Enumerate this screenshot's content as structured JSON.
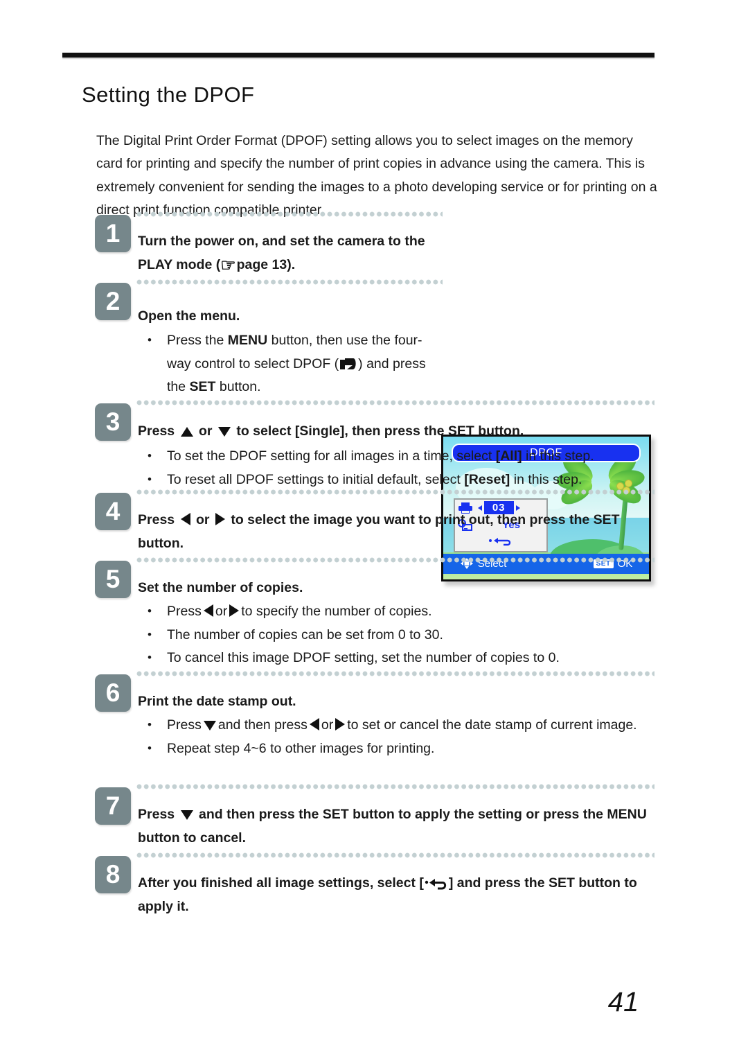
{
  "document": {
    "title": "Setting the DPOF",
    "page_number": "41",
    "intro": "The Digital Print Order Format (DPOF) setting allows you to select images on the memory card for printing and specify the number of print copies in advance using the camera. This is extremely convenient for sending the images to a photo developing service or for printing on a direct print function compatible printer."
  },
  "steps": {
    "s1": {
      "number": "1",
      "text_a": "Turn the power on, and set the camera to the PLAY mode (",
      "text_b": "page 13)."
    },
    "s2": {
      "number": "2",
      "heading": "Open the menu.",
      "bullet_a": "Press the ",
      "bullet_menu": "MENU",
      "bullet_b": " button, then use the four-way control to select DPOF (",
      "bullet_c": ") and press the ",
      "bullet_set": "SET",
      "bullet_d": " button."
    },
    "s3": {
      "number": "3",
      "lead": "Press",
      "or": "or",
      "tail": "to select [Single], then press the SET button.",
      "bullets": [
        {
          "a": "To set the DPOF setting for all images in a time, select ",
          "bold": "[All]",
          "b": " in this step."
        },
        {
          "a": "To reset all DPOF settings to initial default, select ",
          "bold": "[Reset]",
          "b": " in this step."
        }
      ]
    },
    "s4": {
      "number": "4",
      "lead": "Press",
      "or": "or",
      "tail": "to select the image you want to print out, then press the SET button."
    },
    "s5": {
      "number": "5",
      "heading": "Set the number of copies.",
      "bullet1_lead": "Press",
      "bullet1_or": "or",
      "bullet1_tail": "to specify the number of copies.",
      "bullet2": "The number of copies can be set from 0 to 30.",
      "bullet3": "To cancel this image DPOF setting, set the number of copies to 0."
    },
    "s6": {
      "number": "6",
      "heading": "Print the date stamp out.",
      "bullet1_a": "Press",
      "bullet1_b": "and then press",
      "bullet1_or": "or",
      "bullet1_c": "to set or cancel the date stamp of current image.",
      "bullet2": "Repeat step 4~6 to other images for printing."
    },
    "s7": {
      "number": "7",
      "lead": "Press",
      "tail": "and then press the SET button to apply the setting or press the MENU button to cancel."
    },
    "s8": {
      "number": "8",
      "lead": "After you finished all image settings, select [",
      "tail": "] and press the SET button to apply it."
    }
  },
  "lcd": {
    "title": "DPOF",
    "copies_value": "03",
    "datestamp_value": "Yes",
    "hint_select": "Select",
    "hint_set_chip": "SET",
    "hint_ok": "OK",
    "icons": {
      "printer": "printer-icon",
      "datestamp": "date-stamp-icon",
      "return": "return-arrow-icon",
      "fourway": "four-way-icon"
    }
  },
  "icons": {
    "hand": "☞",
    "up": "up-arrow-icon",
    "down": "down-arrow-icon",
    "left": "left-arrow-icon",
    "right": "right-arrow-icon",
    "dpof": "dpof-flag-icon",
    "return": "return-arrow-icon"
  },
  "colors": {
    "badge": "#76878b",
    "dot": "#c3d0d2",
    "lcd_blue": "#1831f0",
    "lcd_bar": "#1565e8",
    "rule": "#111111"
  }
}
